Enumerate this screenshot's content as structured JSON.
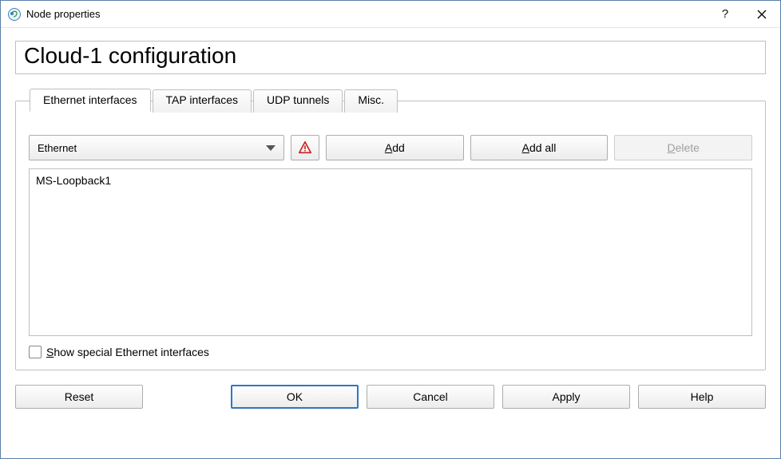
{
  "window": {
    "title": "Node properties"
  },
  "header": {
    "title": "Cloud-1 configuration"
  },
  "tabs": {
    "items": [
      {
        "label": "Ethernet interfaces",
        "active": true
      },
      {
        "label": "TAP interfaces",
        "active": false
      },
      {
        "label": "UDP tunnels",
        "active": false
      },
      {
        "label": "Misc.",
        "active": false
      }
    ]
  },
  "toolbar": {
    "combo_value": "Ethernet",
    "warning_icon": "warning-triangle-icon",
    "add_label": "Add",
    "addall_label": "Add all",
    "delete_label": "Delete",
    "delete_enabled": false
  },
  "list": {
    "items": [
      "MS-Loopback1"
    ]
  },
  "checkbox": {
    "label": "Show special Ethernet interfaces",
    "checked": false
  },
  "footer": {
    "reset_label": "Reset",
    "ok_label": "OK",
    "cancel_label": "Cancel",
    "apply_label": "Apply",
    "help_label": "Help"
  }
}
